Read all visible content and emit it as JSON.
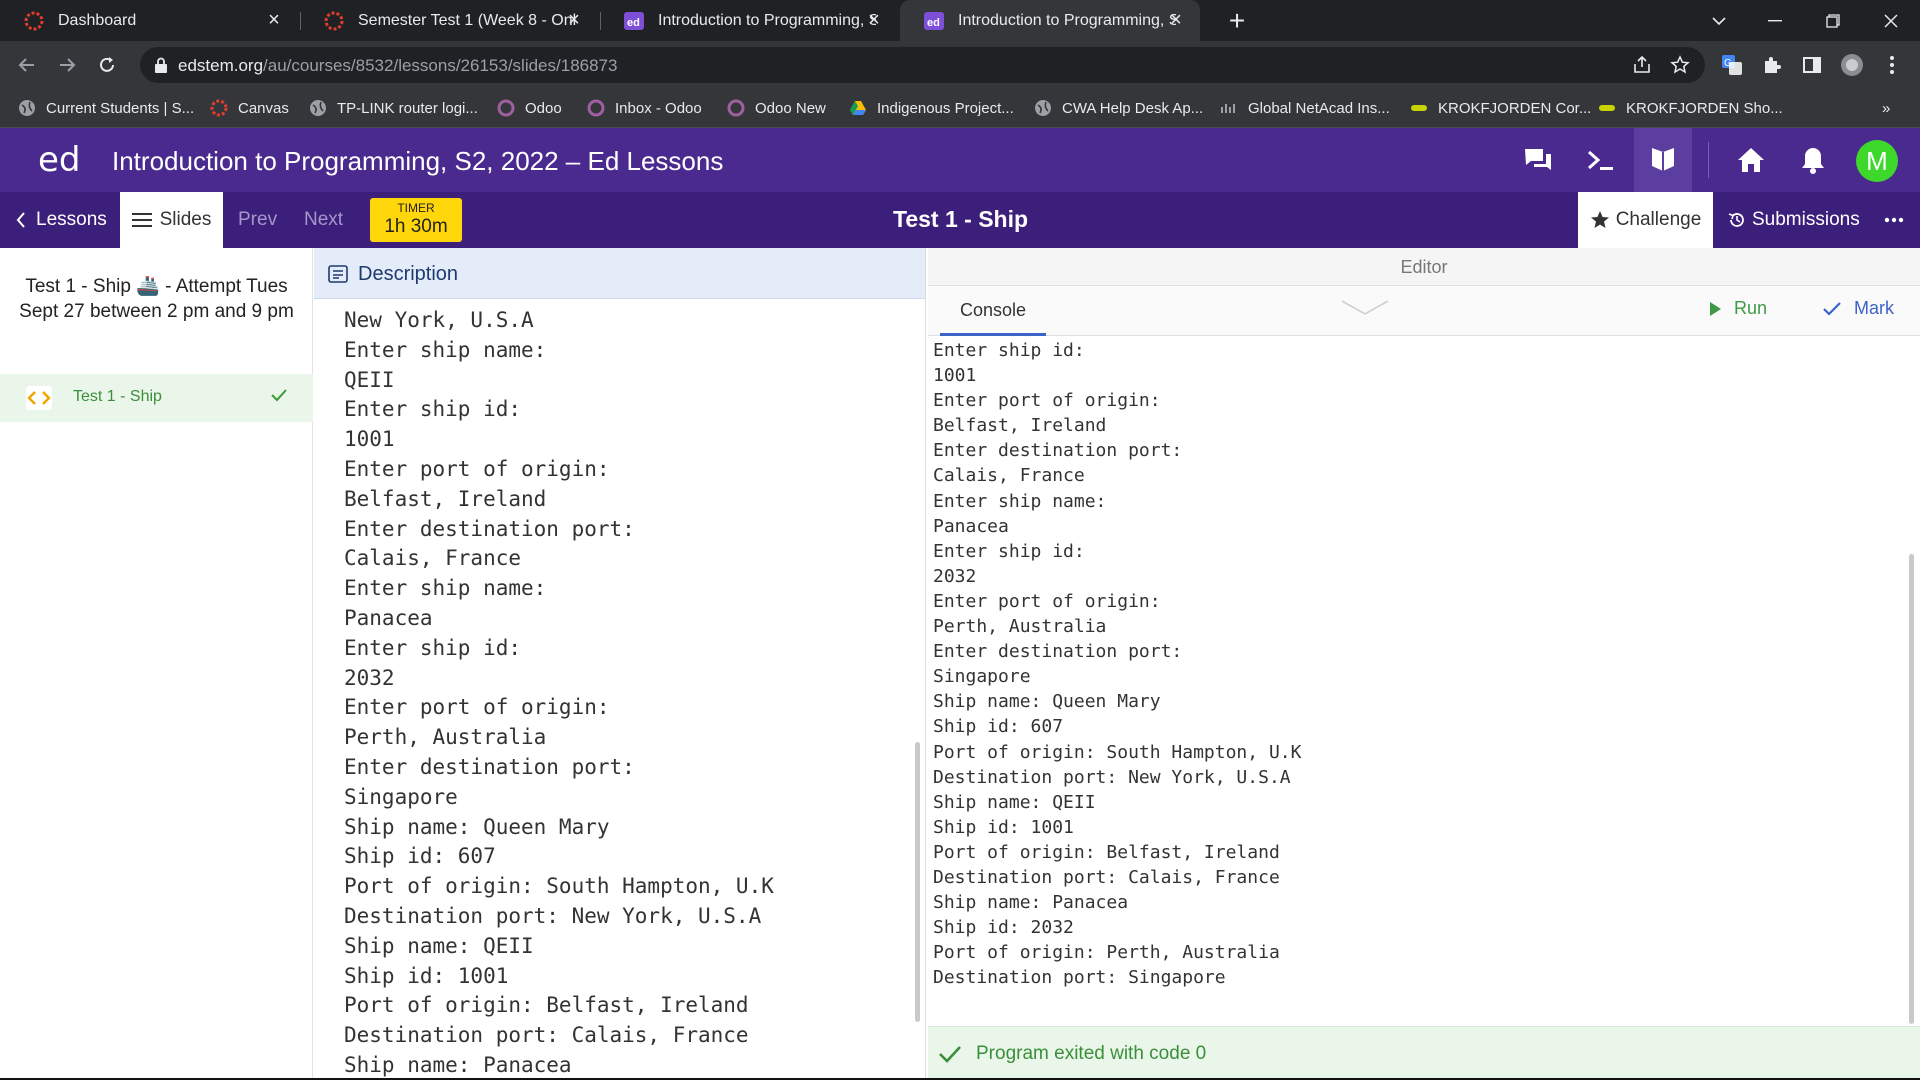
{
  "browser": {
    "tabs": [
      {
        "title": "Dashboard",
        "favicon": "canvas-icon"
      },
      {
        "title": "Semester Test 1 (Week 8 - Online",
        "favicon": "canvas-icon"
      },
      {
        "title": "Introduction to Programming, S2",
        "favicon": "ed-icon"
      },
      {
        "title": "Introduction to Programming, S2",
        "favicon": "ed-icon",
        "active": true
      }
    ],
    "url_host": "edstem.org",
    "url_path": "/au/courses/8532/lessons/26153/slides/186873",
    "bookmarks": [
      "Current Students | S...",
      "Canvas",
      "TP-LINK router logi...",
      "Odoo",
      "Inbox - Odoo",
      "Odoo New",
      "Indigenous Project...",
      "CWA Help Desk Ap...",
      "Global NetAcad Ins...",
      "KROKFJORDEN Cor...",
      "KROKFJORDEN Sho..."
    ]
  },
  "header": {
    "logo": "ed",
    "title": "Introduction to Programming, S2, 2022 – Ed Lessons",
    "avatar_initial": "M",
    "avatar_color": "#3dd82b",
    "brand_color": "#4b2a8f"
  },
  "lessonbar": {
    "lessons_label": "Lessons",
    "slides_label": "Slides",
    "prev_label": "Prev",
    "next_label": "Next",
    "timer_label": "TIMER",
    "timer_value": "1h 30m",
    "slide_title": "Test 1 - Ship",
    "challenge_label": "Challenge",
    "submissions_label": "Submissions"
  },
  "sidebar": {
    "lesson_title": "Test 1 - Ship 🚢 - Attempt Tues Sept 27 between 2 pm and 9 pm",
    "items": [
      {
        "label": "Test 1 - Ship",
        "done": true
      }
    ]
  },
  "description": {
    "title": "Description",
    "lines": [
      "New York, U.S.A",
      "Enter ship name:",
      "QEII",
      "Enter ship id:",
      "1001",
      "Enter port of origin:",
      "Belfast, Ireland",
      "Enter destination port:",
      "Calais, France",
      "Enter ship name:",
      "Panacea",
      "Enter ship id:",
      "2032",
      "Enter port of origin:",
      "Perth, Australia",
      "Enter destination port:",
      "Singapore",
      "Ship name: Queen Mary",
      "Ship id: 607",
      "Port of origin: South Hampton, U.K",
      "Destination port: New York, U.S.A",
      "Ship name: QEII",
      "Ship id: 1001",
      "Port of origin: Belfast, Ireland",
      "Destination port: Calais, France",
      "Ship name: Panacea"
    ]
  },
  "editor": {
    "title": "Editor",
    "console_tab": "Console",
    "run_label": "Run",
    "mark_label": "Mark",
    "output_lines": [
      "Enter ship id:",
      "1001",
      "Enter port of origin:",
      "Belfast, Ireland",
      "Enter destination port:",
      "Calais, France",
      "Enter ship name:",
      "Panacea",
      "Enter ship id:",
      "2032",
      "Enter port of origin:",
      "Perth, Australia",
      "Enter destination port:",
      "Singapore",
      "Ship name: Queen Mary",
      "Ship id: 607",
      "Port of origin: South Hampton, U.K",
      "Destination port: New York, U.S.A",
      "Ship name: QEII",
      "Ship id: 1001",
      "Port of origin: Belfast, Ireland",
      "Destination port: Calais, France",
      "Ship name: Panacea",
      "Ship id: 2032",
      "Port of origin: Perth, Australia",
      "Destination port: Singapore"
    ],
    "exit_message": "Program exited with code 0"
  }
}
